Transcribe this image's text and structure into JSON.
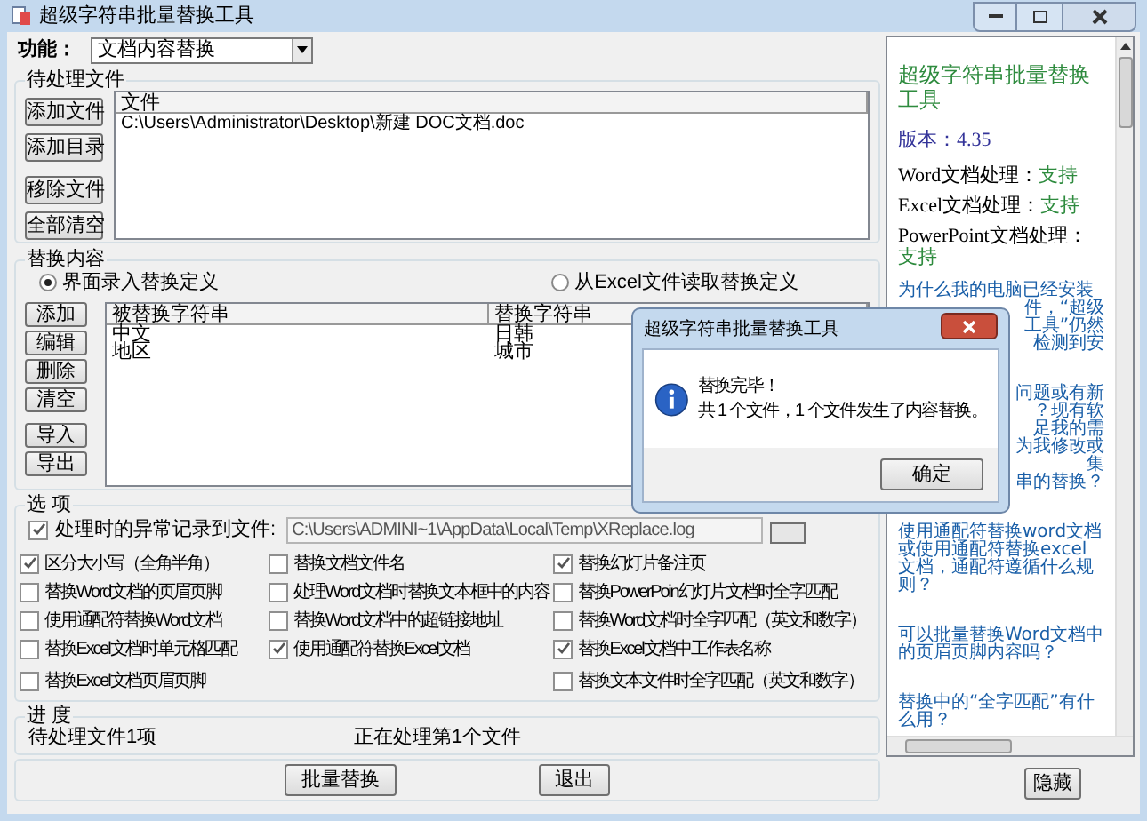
{
  "window": {
    "title": "超级字符串批量替换工具"
  },
  "function_row": {
    "label": "功能：",
    "value": "文档内容替换"
  },
  "files_group": {
    "title": "待处理文件",
    "buttons": [
      "添加文件",
      "添加目录",
      "移除文件",
      "全部清空"
    ],
    "columns": [
      "文件"
    ],
    "rows": [
      "C:\\Users\\Administrator\\Desktop\\新建 DOC文档.doc"
    ]
  },
  "replace_group": {
    "title": "替换内容",
    "radios": [
      {
        "label": "界面录入替换定义",
        "selected": true
      },
      {
        "label": "从Excel文件读取替换定义",
        "selected": false
      }
    ],
    "buttons": [
      "添加",
      "编辑",
      "删除",
      "清空",
      "导入",
      "导出"
    ],
    "columns": [
      "被替换字符串",
      "替换字符串"
    ],
    "rows": [
      [
        "中文",
        "日韩"
      ],
      [
        "地区",
        "城市"
      ]
    ]
  },
  "options_group": {
    "title": "选 项",
    "log": {
      "label": "处理时的异常记录到文件:",
      "checked": true,
      "value": "C:\\Users\\ADMINI~1\\AppData\\Local\\Temp\\XReplace.log"
    },
    "columns": [
      [
        {
          "label": "区分大小写（全角半角）",
          "checked": true
        },
        {
          "label": "替换Word文档的页眉页脚",
          "checked": false
        },
        {
          "label": "使用通配符替换Word文档",
          "checked": false
        },
        {
          "label": "替换Excel文档时单元格匹配",
          "checked": false
        },
        {
          "label": "替换Excel文档页眉页脚",
          "checked": false
        }
      ],
      [
        {
          "label": "替换文档文件名",
          "checked": false
        },
        {
          "label": "处理Word文档时替换文本框中的内容",
          "checked": false
        },
        {
          "label": "替换Word文档中的超链接地址",
          "checked": false
        },
        {
          "label": "使用通配符替换Excel文档",
          "checked": true
        }
      ],
      [
        {
          "label": "替换幻灯片备注页",
          "checked": true
        },
        {
          "label": "替换PowerPoin幻灯片文档时全字匹配",
          "checked": false
        },
        {
          "label": "替换Word文档时全字匹配（英文和数字）",
          "checked": false
        },
        {
          "label": "替换Excel文档中工作表名称",
          "checked": true
        },
        {
          "label": "替换文本文件时全字匹配（英文和数字）",
          "checked": false
        }
      ]
    ]
  },
  "progress_group": {
    "title": "进 度",
    "pending": "待处理文件1项",
    "status": "正在处理第1个文件"
  },
  "actions": [
    "批量替换",
    "退出"
  ],
  "info_panel": {
    "title": "超级字符串批量替换工具",
    "version": "版本：4.35",
    "support": [
      {
        "label": "Word文档处理：",
        "value": "支持"
      },
      {
        "label": "Excel文档处理：",
        "value": "支持"
      },
      {
        "label": "PowerPoint文档处理：",
        "value": "支持"
      }
    ],
    "faq": [
      {
        "lines": [
          {
            "text": "为什么我的电脑已经安装",
            "kind": "full"
          },
          {
            "text": "件，“超级",
            "kind": "partial"
          },
          {
            "text": "工具”仍然",
            "kind": "partial"
          },
          {
            "text": "检测到安",
            "kind": "partial"
          }
        ]
      },
      {
        "lines": [
          {
            "text": "问题或有新",
            "kind": "partial"
          },
          {
            "text": "？现有软",
            "kind": "partial"
          },
          {
            "text": "足我的需",
            "kind": "partial"
          },
          {
            "text": "为我修改或",
            "kind": "partial"
          },
          {
            "text": "集",
            "kind": "partial"
          },
          {
            "text": "串的替换？",
            "kind": "partial"
          }
        ]
      },
      {
        "lines": [
          {
            "text": "使用通配符替换word文档或使用通配符替换excel文档，通配符遵循什么规则？",
            "kind": "full"
          }
        ]
      },
      {
        "lines": [
          {
            "text": "可以批量替换Word文档中的页眉页脚内容吗？",
            "kind": "full"
          }
        ]
      },
      {
        "lines": [
          {
            "text": "替换中的“全字匹配”有什么用？",
            "kind": "full"
          }
        ]
      }
    ],
    "hide_button": "隐藏"
  },
  "dialog": {
    "title": "超级字符串批量替换工具",
    "message": [
      "替换完毕！",
      "共 1 个文件，1 个文件发生了内容替换。"
    ],
    "button": "确定"
  }
}
